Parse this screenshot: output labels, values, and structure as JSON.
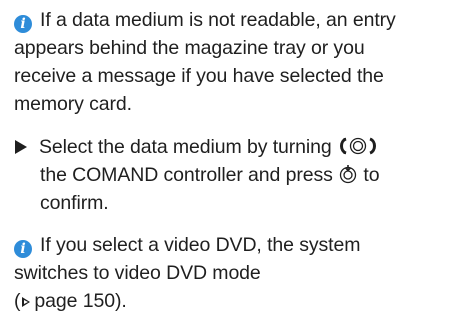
{
  "note1": {
    "icon": "info-icon",
    "icon_glyph": "i",
    "icon_color": "#2e8cd9",
    "lines": [
      "If a data medium is not readable, an entry",
      "appears behind the magazine tray or you",
      "receive a message if you have selected the",
      "memory card."
    ]
  },
  "step1": {
    "icon": "triangle-bullet-icon",
    "line1_before": "Select the data medium by turning",
    "turn_icon": "controller-turn-icon",
    "line2_before": "the COMAND controller and press",
    "press_icon": "controller-press-icon",
    "line2_after": "to",
    "line3": "confirm."
  },
  "note2": {
    "icon": "info-icon",
    "icon_glyph": "i",
    "icon_color": "#2e8cd9",
    "lines": [
      "If you select a video DVD, the system",
      "switches to video DVD mode"
    ],
    "ref_open": "(",
    "ref_icon": "page-reference-arrow-icon",
    "ref_text": "page 150).",
    "ref_page": 150
  }
}
